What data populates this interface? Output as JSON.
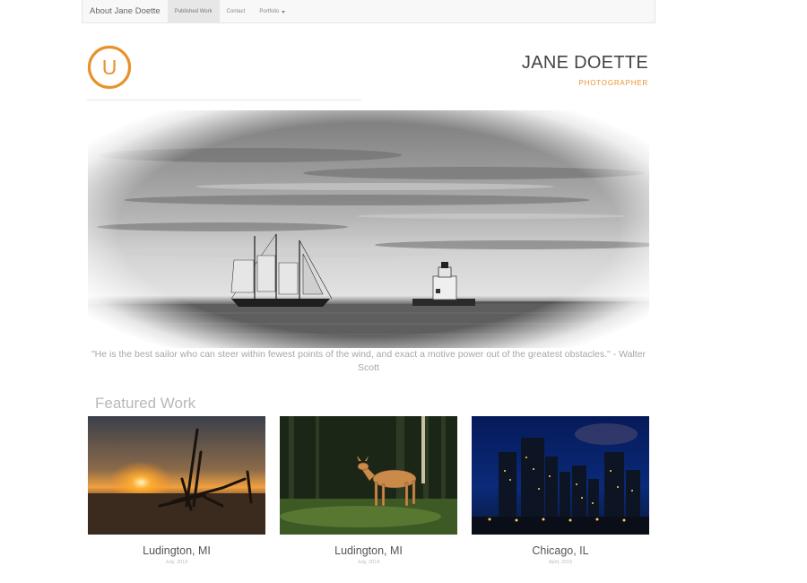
{
  "navbar": {
    "brand": "About Jane Doette",
    "items": [
      {
        "label": "Published Work",
        "active": true
      },
      {
        "label": "Contact",
        "active": false
      },
      {
        "label": "Portfolio",
        "active": false,
        "dropdown": true
      }
    ]
  },
  "header": {
    "logo_letter": "U",
    "name": "JANE DOETTE",
    "role": "PHOTOGRAPHER",
    "accent_color": "#e8922b"
  },
  "hero": {
    "icon": "tall-ship-and-lighthouse-photo"
  },
  "quote": {
    "text": "\"He is the best sailor who can steer within fewest points of the wind, and exact a motive power out of the greatest obstacles.\" - Walter Scott"
  },
  "featured": {
    "title": "Featured Work",
    "cards": [
      {
        "place": "Ludington, MI",
        "date": "July, 2013",
        "icon": "sunset-driftwood-photo"
      },
      {
        "place": "Ludington, MI",
        "date": "July, 2014",
        "icon": "deer-in-forest-photo"
      },
      {
        "place": "Chicago, IL",
        "date": "April, 2015",
        "icon": "city-skyline-night-photo"
      }
    ]
  }
}
